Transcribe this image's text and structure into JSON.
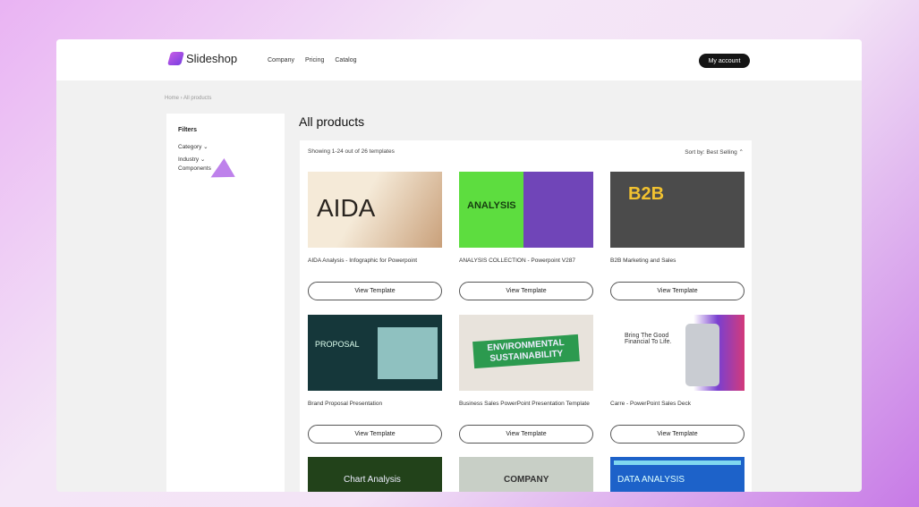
{
  "header": {
    "brand": "Slideshop",
    "nav": [
      "Company",
      "Pricing",
      "Catalog"
    ],
    "account": "My account"
  },
  "breadcrumb": "Home  ›  All products",
  "filters": {
    "title": "Filters",
    "items": [
      "Category ⌄",
      "Industry ⌄",
      "Components"
    ]
  },
  "page_title": "All products",
  "results": {
    "showing": "Showing 1-24 out of 26 templates",
    "sort": "Sort by: Best Selling ⌃"
  },
  "products": [
    {
      "title": "AIDA Analysis - Infographic for Powerpoint",
      "thumb_text": "AIDA",
      "button": "View Template"
    },
    {
      "title": "ANALYSIS COLLECTION - Powerpoint V287",
      "thumb_text": "ANALYSIS",
      "button": "View Template"
    },
    {
      "title": "B2B Marketing and Sales",
      "thumb_text": "B2B",
      "button": "View Template"
    },
    {
      "title": "Brand Proposal Presentation",
      "thumb_text": "PROPOSAL",
      "button": "View Template"
    },
    {
      "title": "Business Sales PowerPoint Presentation Template",
      "thumb_text": "ENVIRONMENTAL SUSTAINABILITY",
      "button": "View Template"
    },
    {
      "title": "Carre - PowerPoint Sales Deck",
      "thumb_text": "Bring The Good Financial To Life.",
      "button": "View Template"
    },
    {
      "thumb_text": "Chart Analysis"
    },
    {
      "thumb_text": "COMPANY"
    },
    {
      "thumb_text": "DATA ANALYSIS"
    }
  ]
}
